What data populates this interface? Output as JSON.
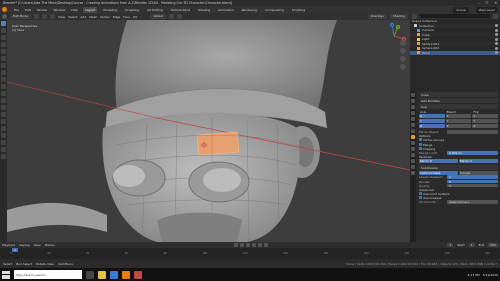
{
  "window": {
    "title": "Blender* [C:\\Users\\Alex The Mesh\\Desktop\\Course - Creating Animations from A-Z\\Blender 2D\\04 - Modeling Our 3D Character\\Character.blend]",
    "controls": [
      "–",
      "☐",
      "✕"
    ]
  },
  "menubar": {
    "menus": [
      "File",
      "Edit",
      "Render",
      "Window",
      "Help"
    ],
    "workspaces": [
      "Layout",
      "Modeling",
      "Sculpting",
      "UV Editing",
      "Texture Paint",
      "Shading",
      "Animation",
      "Rendering",
      "Compositing",
      "Scripting"
    ],
    "active_workspace": "Layout",
    "scene": "Scene",
    "view_layer": "View Layer"
  },
  "viewport_header": {
    "mode": "Edit Mode",
    "menus": [
      "View",
      "Select",
      "Add",
      "Mesh",
      "Vertex",
      "Edge",
      "Face",
      "UV"
    ],
    "transform": "Global",
    "overlays": "Overlays",
    "shading": "Shading"
  },
  "viewport": {
    "info_line1": "User Perspective",
    "info_line2": "(1) Face",
    "accent": "#e6a070",
    "red_axis": "#c34646"
  },
  "gizmo": {
    "x": "X",
    "y": "Y",
    "z": "Z"
  },
  "outliner": {
    "title": "Scene Collection",
    "rows": [
      {
        "label": "Collection",
        "color": "#cccccc",
        "selected": false
      },
      {
        "label": "Camera",
        "color": "#4aa3df",
        "selected": false
      },
      {
        "label": "Cube",
        "color": "#e8a040",
        "selected": false
      },
      {
        "label": "Light",
        "color": "#e8d040",
        "selected": false
      },
      {
        "label": "Sphere.001",
        "color": "#e8a040",
        "selected": false
      },
      {
        "label": "Sphere.002",
        "color": "#e8a040",
        "selected": false
      },
      {
        "label": "Torus",
        "color": "#e8a040",
        "selected": true
      }
    ]
  },
  "properties": {
    "object_name": "Cube",
    "modifier_panel": "Add Modifier",
    "mirror_name": "Sub",
    "axis_header": [
      "Axis",
      "Bisect",
      "Flip"
    ],
    "axis_values": [
      "X",
      "X",
      "X",
      "Y",
      "Y",
      "Y",
      "Z",
      "Z",
      "Z"
    ],
    "mirror_object_label": "Mirror Object",
    "options_label": "Options",
    "options": [
      {
        "label": "Vertex Groups",
        "on": true
      },
      {
        "label": "Merge",
        "on": true
      },
      {
        "label": "Clipping",
        "on": true
      }
    ],
    "merge_label": "Merge Limit",
    "merge_value": "0.001 m",
    "data_label": "Textures",
    "uv_label": "Mirror U",
    "uv_value": "Mirror V",
    "subdiv_name": "Subdivision",
    "subdiv_buttons": [
      "Catmull-Clark",
      "Simple"
    ],
    "levels": [
      {
        "label": "Levels Viewport",
        "value": "1"
      },
      {
        "label": "Render",
        "value": "2"
      }
    ],
    "quality_label": "Quality",
    "quality_value": "3",
    "advanced_label": "Advanced",
    "advanced_rows": [
      {
        "label": "Use Limit Surface",
        "on": true
      },
      {
        "label": "Use Creases",
        "on": true
      }
    ],
    "uv_smooth_label": "UV Smooth",
    "uv_smooth_value": "Keep Corners"
  },
  "timeline": {
    "menus": [
      "Playback",
      "Keying",
      "View",
      "Marker"
    ],
    "frame": "1",
    "start_label": "Start",
    "start": "1",
    "end_label": "End",
    "end": "250",
    "ticks": [
      "0",
      "20",
      "40",
      "60",
      "80",
      "100",
      "120",
      "140",
      "160",
      "180",
      "200",
      "220",
      "240"
    ]
  },
  "statusbar": {
    "select": "Select",
    "box_select": "Box Select",
    "rotate": "Rotate View",
    "menu": "Call Menu",
    "stats": "Cube | Verts 1,897/16,964 | Faces 1,902/16,592 | Tris 32,946 | Objects 1/5 | Mem: 68.5 MiB | v2.82.7"
  },
  "taskbar": {
    "search_placeholder": "Type here to search",
    "time": "4:23 PM",
    "date": "3/19/2020"
  }
}
